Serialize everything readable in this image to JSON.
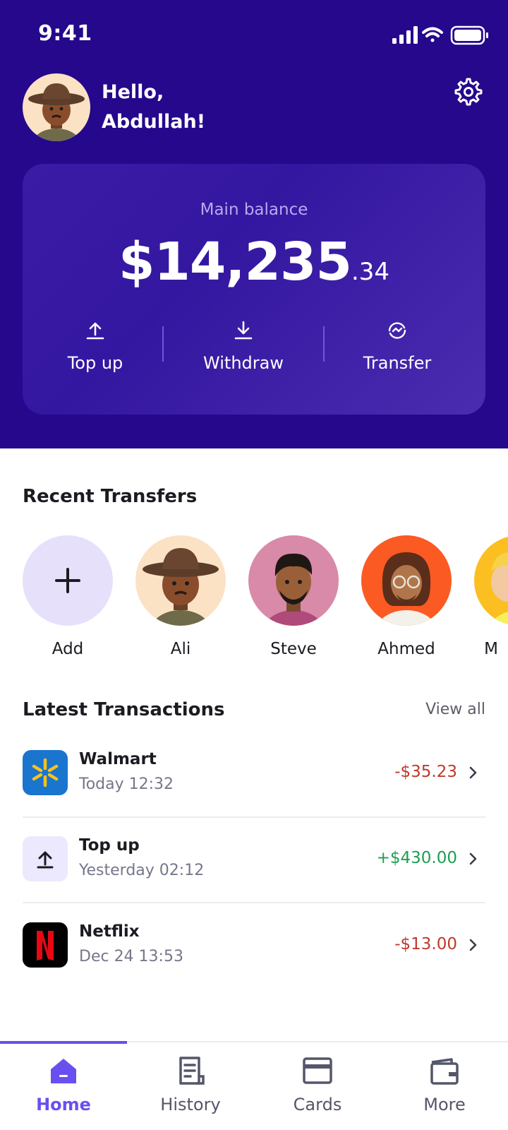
{
  "status_bar": {
    "time": "9:41"
  },
  "header": {
    "greeting_line1": "Hello,",
    "greeting_line2": "Abdullah!"
  },
  "balance": {
    "label": "Main balance",
    "amount_main": "$14,235",
    "amount_cents": ".34"
  },
  "actions": [
    {
      "label": "Top up",
      "icon": "upload-icon"
    },
    {
      "label": "Withdraw",
      "icon": "download-icon"
    },
    {
      "label": "Transfer",
      "icon": "transfer-icon"
    }
  ],
  "recent_transfers": {
    "title": "Recent Transfers",
    "contacts": [
      {
        "name": "Add",
        "color": "#e6e0fb"
      },
      {
        "name": "Ali",
        "color": "#fbe2c5"
      },
      {
        "name": "Steve",
        "color": "#d88aa8"
      },
      {
        "name": "Ahmed",
        "color": "#fb5a22"
      },
      {
        "name": "M",
        "color": "#fbbf22"
      }
    ]
  },
  "transactions": {
    "title": "Latest Transactions",
    "view_all": "View all",
    "items": [
      {
        "name": "Walmart",
        "date": "Today 12:32",
        "amount": "-$35.23",
        "amount_color": "#c0392b",
        "logo": "walmart-logo",
        "logo_color": "#1a75cf"
      },
      {
        "name": "Top up",
        "date": "Yesterday 02:12",
        "amount": "+$430.00",
        "amount_color": "#1e9e54",
        "logo": "upload-icon",
        "logo_color": "#ece8fd"
      },
      {
        "name": "Netflix",
        "date": "Dec 24 13:53",
        "amount": "-$13.00",
        "amount_color": "#c0392b",
        "logo": "netflix-logo",
        "logo_color": "#000000"
      }
    ]
  },
  "bottom_nav": {
    "active_index": 0,
    "items": [
      {
        "label": "Home",
        "icon": "home-icon"
      },
      {
        "label": "History",
        "icon": "history-icon"
      },
      {
        "label": "Cards",
        "icon": "card-icon"
      },
      {
        "label": "More",
        "icon": "wallet-icon"
      }
    ]
  },
  "colors": {
    "header_bg": "#25088c",
    "accent": "#6a4ff0",
    "debit": "#c0392b",
    "credit": "#1e9e54"
  }
}
